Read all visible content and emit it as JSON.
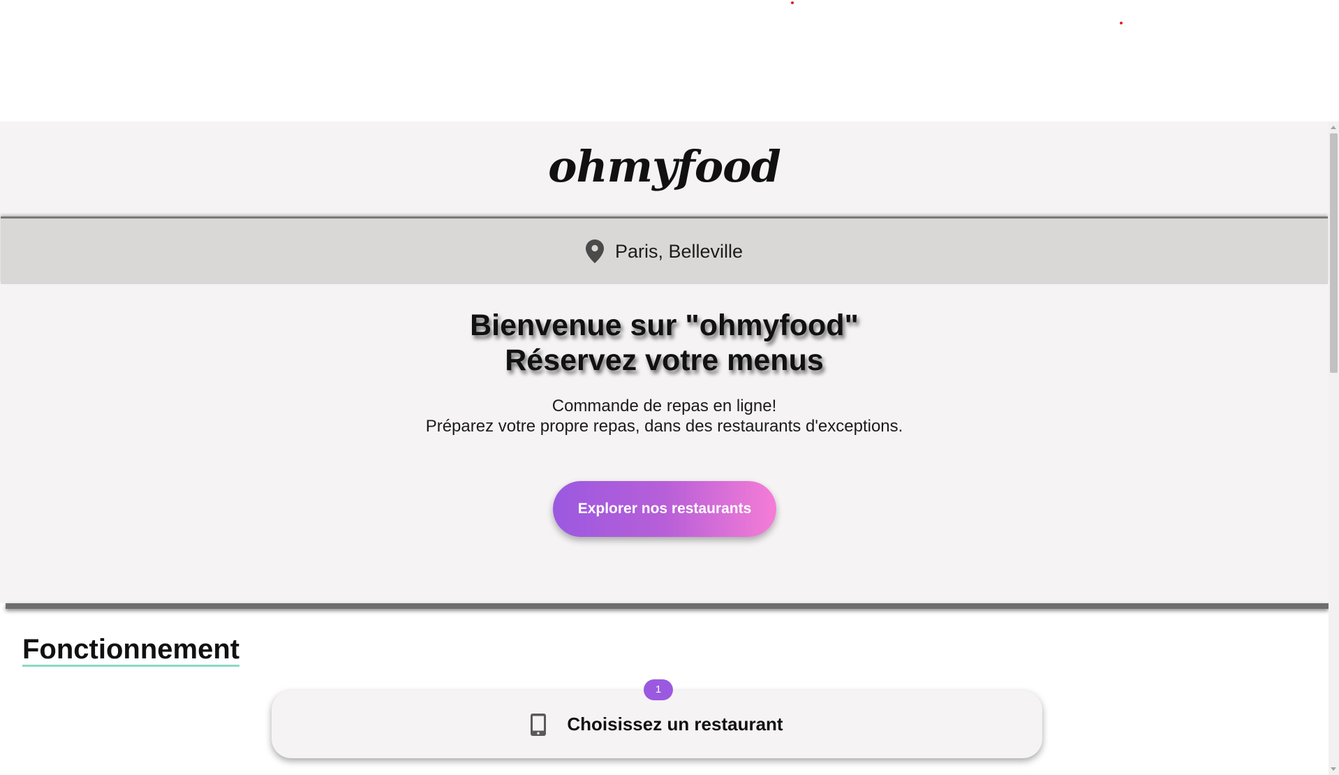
{
  "header": {
    "logo_text": "ohmyfood"
  },
  "location": {
    "icon": "map-pin-icon",
    "text": "Paris, Belleville"
  },
  "hero": {
    "title_line1": "Bienvenue sur \"ohmyfood\"",
    "title_line2": "Réservez votre menus",
    "subtitle_line1": "Commande de repas en ligne!",
    "subtitle_line2": "Préparez votre propre repas, dans des restaurants d'exceptions.",
    "cta_label": "Explorer nos restaurants"
  },
  "how_it_works": {
    "title": "Fonctionnement",
    "steps": [
      {
        "number": "1",
        "icon": "mobile-phone-icon",
        "label": "Choisissez un restaurant"
      }
    ]
  },
  "colors": {
    "page_background": "#f5f3f4",
    "location_bar": "#d9d8d7",
    "cta_gradient_start": "#9b59e0",
    "cta_gradient_end": "#f57dd6",
    "badge": "#9b59e0",
    "title_underline": "#8ad9c4"
  }
}
